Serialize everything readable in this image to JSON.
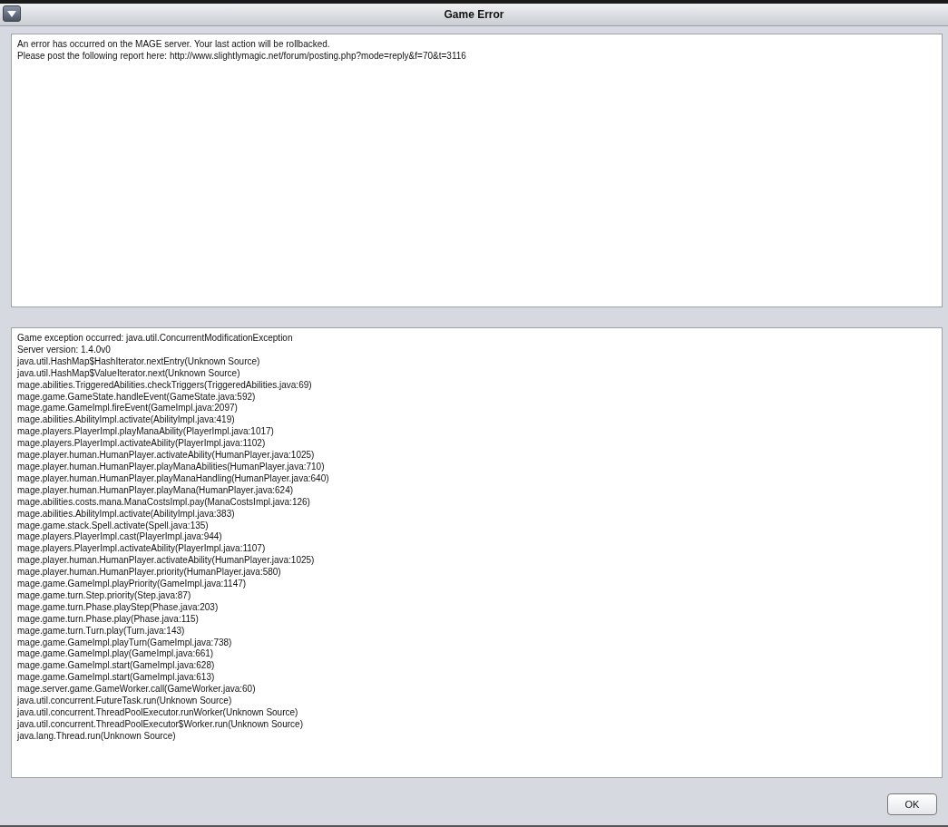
{
  "window": {
    "title": "Game Error"
  },
  "message_lines": [
    "An error has occurred on the MAGE server. Your last action will be rollbacked.",
    "Please post the following report here: http://www.slightlymagic.net/forum/posting.php?mode=reply&f=70&t=3116"
  ],
  "report_lines": [
    "Game exception occurred: java.util.ConcurrentModificationException",
    "Server version: 1.4.0v0",
    "java.util.HashMap$HashIterator.nextEntry(Unknown Source)",
    "java.util.HashMap$ValueIterator.next(Unknown Source)",
    "mage.abilities.TriggeredAbilities.checkTriggers(TriggeredAbilities.java:69)",
    "mage.game.GameState.handleEvent(GameState.java:592)",
    "mage.game.GameImpl.fireEvent(GameImpl.java:2097)",
    "mage.abilities.AbilityImpl.activate(AbilityImpl.java:419)",
    "mage.players.PlayerImpl.playManaAbility(PlayerImpl.java:1017)",
    "mage.players.PlayerImpl.activateAbility(PlayerImpl.java:1102)",
    "mage.player.human.HumanPlayer.activateAbility(HumanPlayer.java:1025)",
    "mage.player.human.HumanPlayer.playManaAbilities(HumanPlayer.java:710)",
    "mage.player.human.HumanPlayer.playManaHandling(HumanPlayer.java:640)",
    "mage.player.human.HumanPlayer.playMana(HumanPlayer.java:624)",
    "mage.abilities.costs.mana.ManaCostsImpl.pay(ManaCostsImpl.java:126)",
    "mage.abilities.AbilityImpl.activate(AbilityImpl.java:383)",
    "mage.game.stack.Spell.activate(Spell.java:135)",
    "mage.players.PlayerImpl.cast(PlayerImpl.java:944)",
    "mage.players.PlayerImpl.activateAbility(PlayerImpl.java:1107)",
    "mage.player.human.HumanPlayer.activateAbility(HumanPlayer.java:1025)",
    "mage.player.human.HumanPlayer.priority(HumanPlayer.java:580)",
    "mage.game.GameImpl.playPriority(GameImpl.java:1147)",
    "mage.game.turn.Step.priority(Step.java:87)",
    "mage.game.turn.Phase.playStep(Phase.java:203)",
    "mage.game.turn.Phase.play(Phase.java:115)",
    "mage.game.turn.Turn.play(Turn.java:143)",
    "mage.game.GameImpl.playTurn(GameImpl.java:738)",
    "mage.game.GameImpl.play(GameImpl.java:661)",
    "mage.game.GameImpl.start(GameImpl.java:628)",
    "mage.game.GameImpl.start(GameImpl.java:613)",
    "mage.server.game.GameWorker.call(GameWorker.java:60)",
    "java.util.concurrent.FutureTask.run(Unknown Source)",
    "java.util.concurrent.ThreadPoolExecutor.runWorker(Unknown Source)",
    "java.util.concurrent.ThreadPoolExecutor$Worker.run(Unknown Source)",
    "java.lang.Thread.run(Unknown Source)"
  ],
  "buttons": [
    "OK"
  ]
}
